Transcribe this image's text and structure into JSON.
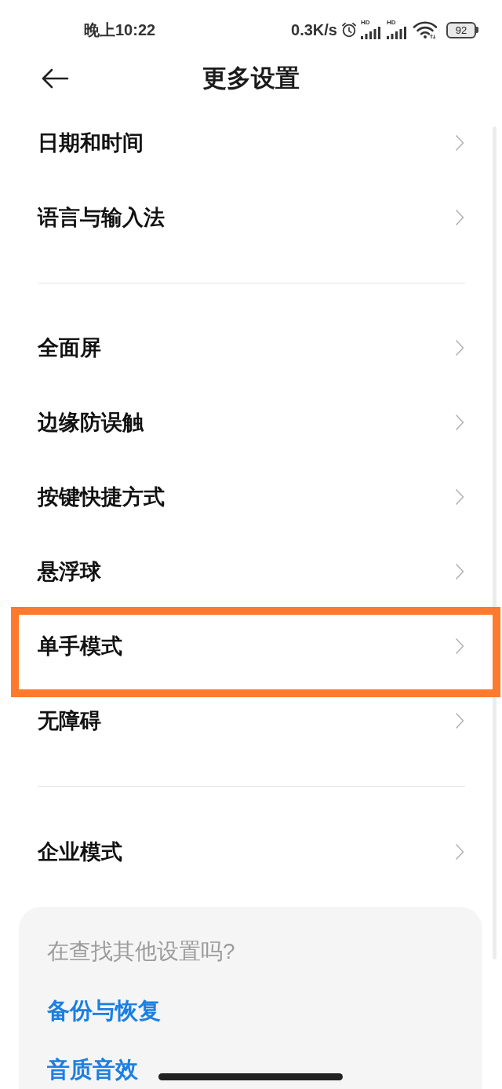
{
  "status_bar": {
    "time": "晚上10:22",
    "net_speed": "0.3K/s",
    "signals": [
      {
        "label": "HD"
      },
      {
        "label": "HD"
      }
    ],
    "battery": "92"
  },
  "header": {
    "title": "更多设置"
  },
  "groups": [
    {
      "items": [
        {
          "label": "日期和时间",
          "highlighted": false
        },
        {
          "label": "语言与输入法",
          "highlighted": false
        }
      ]
    },
    {
      "items": [
        {
          "label": "全面屏",
          "highlighted": false
        },
        {
          "label": "边缘防误触",
          "highlighted": false
        },
        {
          "label": "按键快捷方式",
          "highlighted": false
        },
        {
          "label": "悬浮球",
          "highlighted": false
        },
        {
          "label": "单手模式",
          "highlighted": true
        },
        {
          "label": "无障碍",
          "highlighted": false
        }
      ]
    },
    {
      "items": [
        {
          "label": "企业模式",
          "highlighted": false
        }
      ]
    }
  ],
  "suggestions": {
    "title": "在查找其他设置吗?",
    "links": [
      "备份与恢复",
      "音质音效"
    ]
  }
}
